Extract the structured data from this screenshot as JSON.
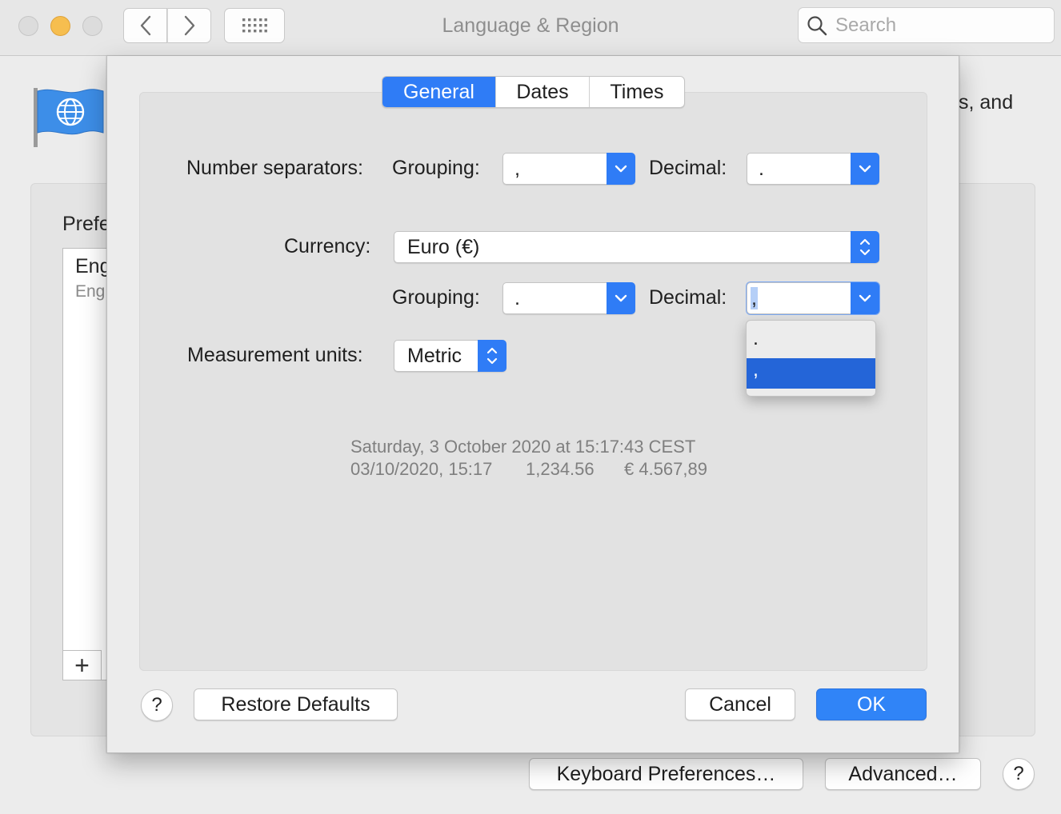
{
  "window": {
    "title": "Language & Region",
    "search_placeholder": "Search"
  },
  "background": {
    "description_fragment": "s, and",
    "preferred_label": "Prefe",
    "list_items": [
      {
        "primary": "Eng",
        "secondary": "Eng"
      }
    ],
    "add_symbol": "+",
    "keyboard_button": "Keyboard Preferences…",
    "advanced_button": "Advanced…",
    "help_symbol": "?"
  },
  "sheet": {
    "tabs": [
      {
        "label": "General",
        "active": true
      },
      {
        "label": "Dates",
        "active": false
      },
      {
        "label": "Times",
        "active": false
      }
    ],
    "number_separators": {
      "label": "Number separators:",
      "grouping_label": "Grouping:",
      "grouping_value": ",",
      "decimal_label": "Decimal:",
      "decimal_value": "."
    },
    "currency": {
      "label": "Currency:",
      "value": "Euro (€)",
      "grouping_label": "Grouping:",
      "grouping_value": ".",
      "decimal_label": "Decimal:",
      "decimal_value": ","
    },
    "decimal_dropdown": {
      "options": [
        ".",
        ","
      ],
      "highlighted_index": 1
    },
    "measurement": {
      "label": "Measurement units:",
      "value": "Metric"
    },
    "sample": {
      "line1": "Saturday, 3 October 2020 at 15:17:43 CEST",
      "date_time": "03/10/2020, 15:17",
      "number": "1,234.56",
      "currency": "€ 4.567,89"
    },
    "help_symbol": "?",
    "restore_button": "Restore Defaults",
    "cancel_button": "Cancel",
    "ok_button": "OK"
  },
  "colors": {
    "accent": "#2f7cf6",
    "highlight": "#2465d8",
    "minimize": "#f6be4f"
  }
}
